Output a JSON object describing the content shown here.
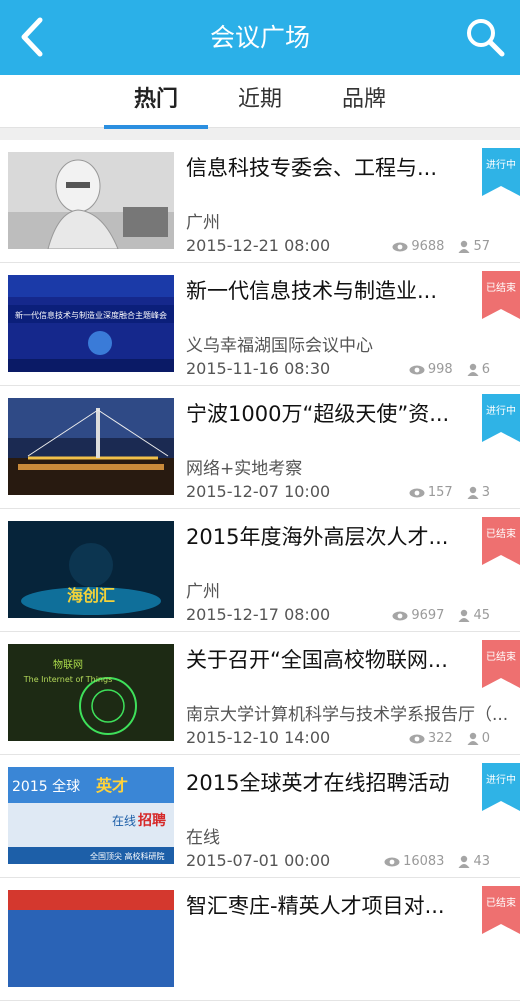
{
  "header": {
    "title": "会议广场"
  },
  "tabs": [
    {
      "label": "热门"
    },
    {
      "label": "近期"
    },
    {
      "label": "品牌"
    }
  ],
  "colors": {
    "primary": "#2bb0e8",
    "ongoing": "#2fb3e6",
    "ended": "#ee7070"
  },
  "items": [
    {
      "title": "信息科技专委会、工程与...",
      "location": "广州",
      "datetime": "2015-12-21 08:00",
      "views": "9688",
      "people": "57",
      "status": "进行中",
      "status_type": "ongoing"
    },
    {
      "title": "新一代信息技术与制造业...",
      "location": "义乌幸福湖国际会议中心",
      "datetime": "2015-11-16 08:30",
      "views": "998",
      "people": "6",
      "status": "已结束",
      "status_type": "ended"
    },
    {
      "title": "宁波1000万“超级天使”资...",
      "location": "网络+实地考察",
      "datetime": "2015-12-07 10:00",
      "views": "157",
      "people": "3",
      "status": "进行中",
      "status_type": "ongoing"
    },
    {
      "title": "2015年度海外高层次人才...",
      "location": "广州",
      "datetime": "2015-12-17 08:00",
      "views": "9697",
      "people": "45",
      "status": "已结束",
      "status_type": "ended"
    },
    {
      "title": "关于召开“全国高校物联网...",
      "location": "南京大学计算机科学与技术学系报告厅（...",
      "datetime": "2015-12-10 14:00",
      "views": "322",
      "people": "0",
      "status": "已结束",
      "status_type": "ended"
    },
    {
      "title": "2015全球英才在线招聘活动",
      "location": "在线",
      "datetime": "2015-07-01 00:00",
      "views": "16083",
      "people": "43",
      "status": "进行中",
      "status_type": "ongoing"
    },
    {
      "title": "智汇枣庄-精英人才项目对...",
      "location": "",
      "datetime": "",
      "views": "",
      "people": "",
      "status": "已结束",
      "status_type": "ended"
    }
  ],
  "thumb_text": {
    "t2_line": "新一代信息技术与制造业深度融合主题峰会",
    "t4_text": "海创汇",
    "t5_cn": "物联网",
    "t5_en": "The Internet of Things",
    "t6_a": "2015 全球",
    "t6_b": "英才",
    "t6_c": "在线",
    "t6_d": "招聘",
    "t6_e": "全国顶尖 高校科研院"
  }
}
